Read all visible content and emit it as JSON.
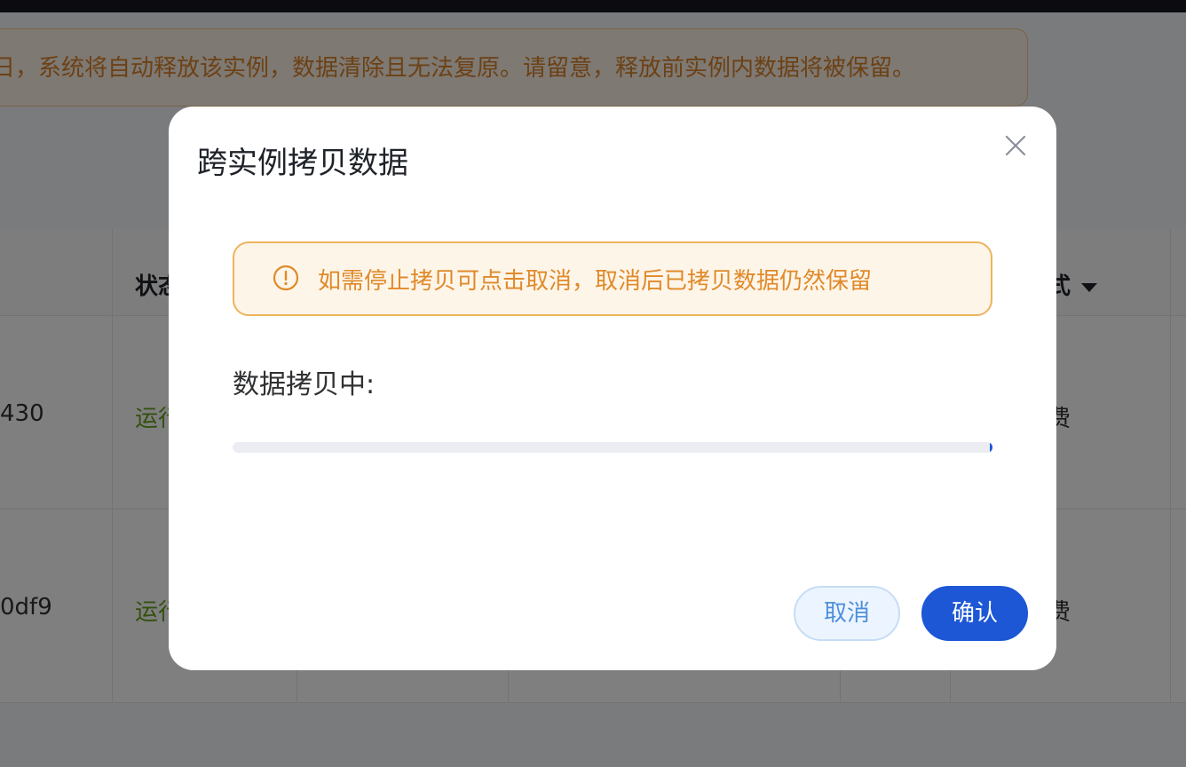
{
  "notice": {
    "text": "日，系统将自动释放该实例，数据清除且无法复原。请留意，释放前实例内数据将被保留。"
  },
  "table": {
    "headers": {
      "status": "状态",
      "billing": "式"
    },
    "rows": [
      {
        "id": "430",
        "status": "运行",
        "billing": "费"
      },
      {
        "id": "0df9",
        "status": "运行",
        "billing": "费"
      }
    ]
  },
  "modal": {
    "title": "跨实例拷贝数据",
    "alert_text": "如需停止拷贝可点击取消，取消后已拷贝数据仍然保留",
    "progress_label": "数据拷贝中:",
    "progress_value": 0.003,
    "cancel_label": "取消",
    "confirm_label": "确认"
  },
  "colors": {
    "primary": "#1d57d6",
    "warning": "#e08a2a",
    "success": "#67a31b"
  },
  "icons": {
    "close": "close-icon",
    "warning": "warning-circle-icon",
    "sort": "caret-down-icon"
  }
}
